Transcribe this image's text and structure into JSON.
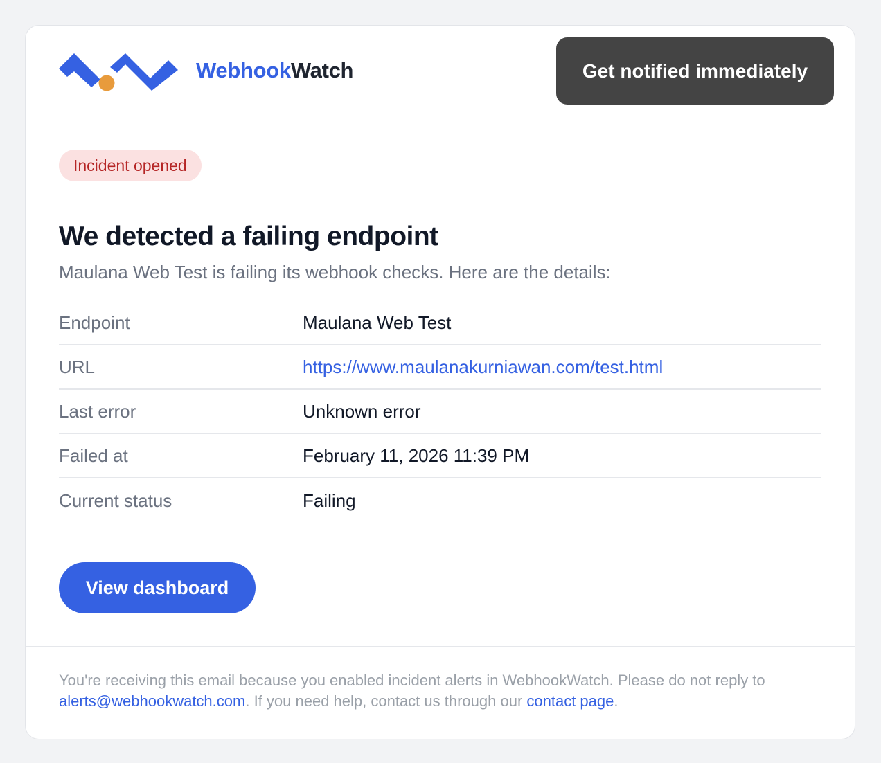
{
  "brand": {
    "name_part1": "Webhook",
    "name_part2": "Watch",
    "logo": "webhookwatch-logo",
    "colors": {
      "blue": "#3561e2",
      "orange": "#e89b3c",
      "dark": "#1f2530"
    }
  },
  "header": {
    "cta_label": "Get notified immediately"
  },
  "badge": {
    "label": "Incident opened",
    "color": "#b52626",
    "background": "#fbe1e1"
  },
  "main": {
    "title": "We detected a failing endpoint",
    "subtitle": "Maulana Web Test is failing its webhook checks. Here are the details:"
  },
  "details": [
    {
      "label": "Endpoint",
      "value": "Maulana Web Test"
    },
    {
      "label": "URL",
      "value": "https://www.maulanakurniawan.com/test.html"
    },
    {
      "label": "Last error",
      "value": "Unknown error"
    },
    {
      "label": "Failed at",
      "value": "February 11, 2026 11:39 PM"
    },
    {
      "label": "Current status",
      "value": "Failing"
    }
  ],
  "dashboard_button": {
    "label": "View dashboard"
  },
  "footer": {
    "text1": "You're receiving this email because you enabled incident alerts in WebhookWatch. Please do not reply to ",
    "email_link": "alerts@webhookwatch.com",
    "text2": ". If you need help, contact us through our ",
    "contact_link": "contact page",
    "text3": "."
  }
}
